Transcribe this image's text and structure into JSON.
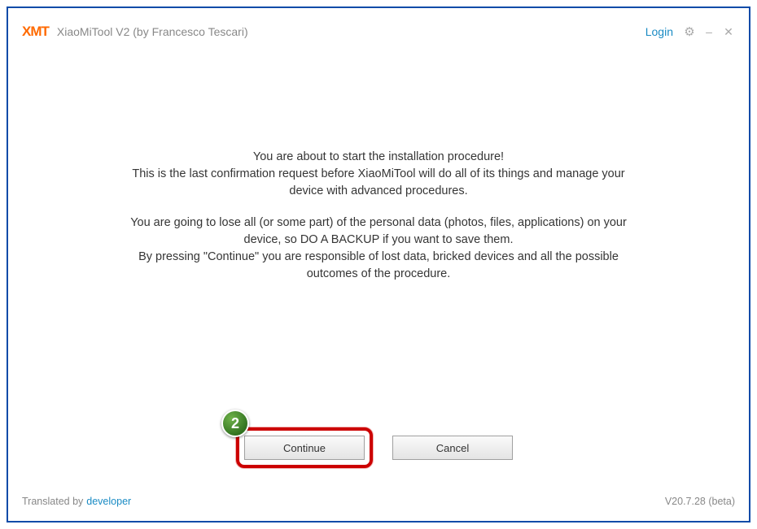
{
  "header": {
    "logo_text": "XMT",
    "app_title": "XiaoMiTool V2 (by Francesco Tescari)",
    "login_label": "Login"
  },
  "message": {
    "p1_l1": "You are about to start the installation procedure!",
    "p1_l2": "This is the last confirmation request before XiaoMiTool will do all of its things and manage your",
    "p1_l3": "device with advanced procedures.",
    "p2_l1": "You are going to lose all (or some part) of the personal data (photos, files, applications) on your",
    "p2_l2": "device, so DO A BACKUP if you want to save them.",
    "p2_l3": "By pressing \"Continue\" you are responsible of lost data, bricked devices and all the possible",
    "p2_l4": "outcomes of the procedure."
  },
  "buttons": {
    "continue_label": "Continue",
    "cancel_label": "Cancel"
  },
  "annotation": {
    "badge_number": "2"
  },
  "footer": {
    "translated_prefix": "Translated by",
    "developer_label": "developer",
    "version": "V20.7.28 (beta)"
  }
}
